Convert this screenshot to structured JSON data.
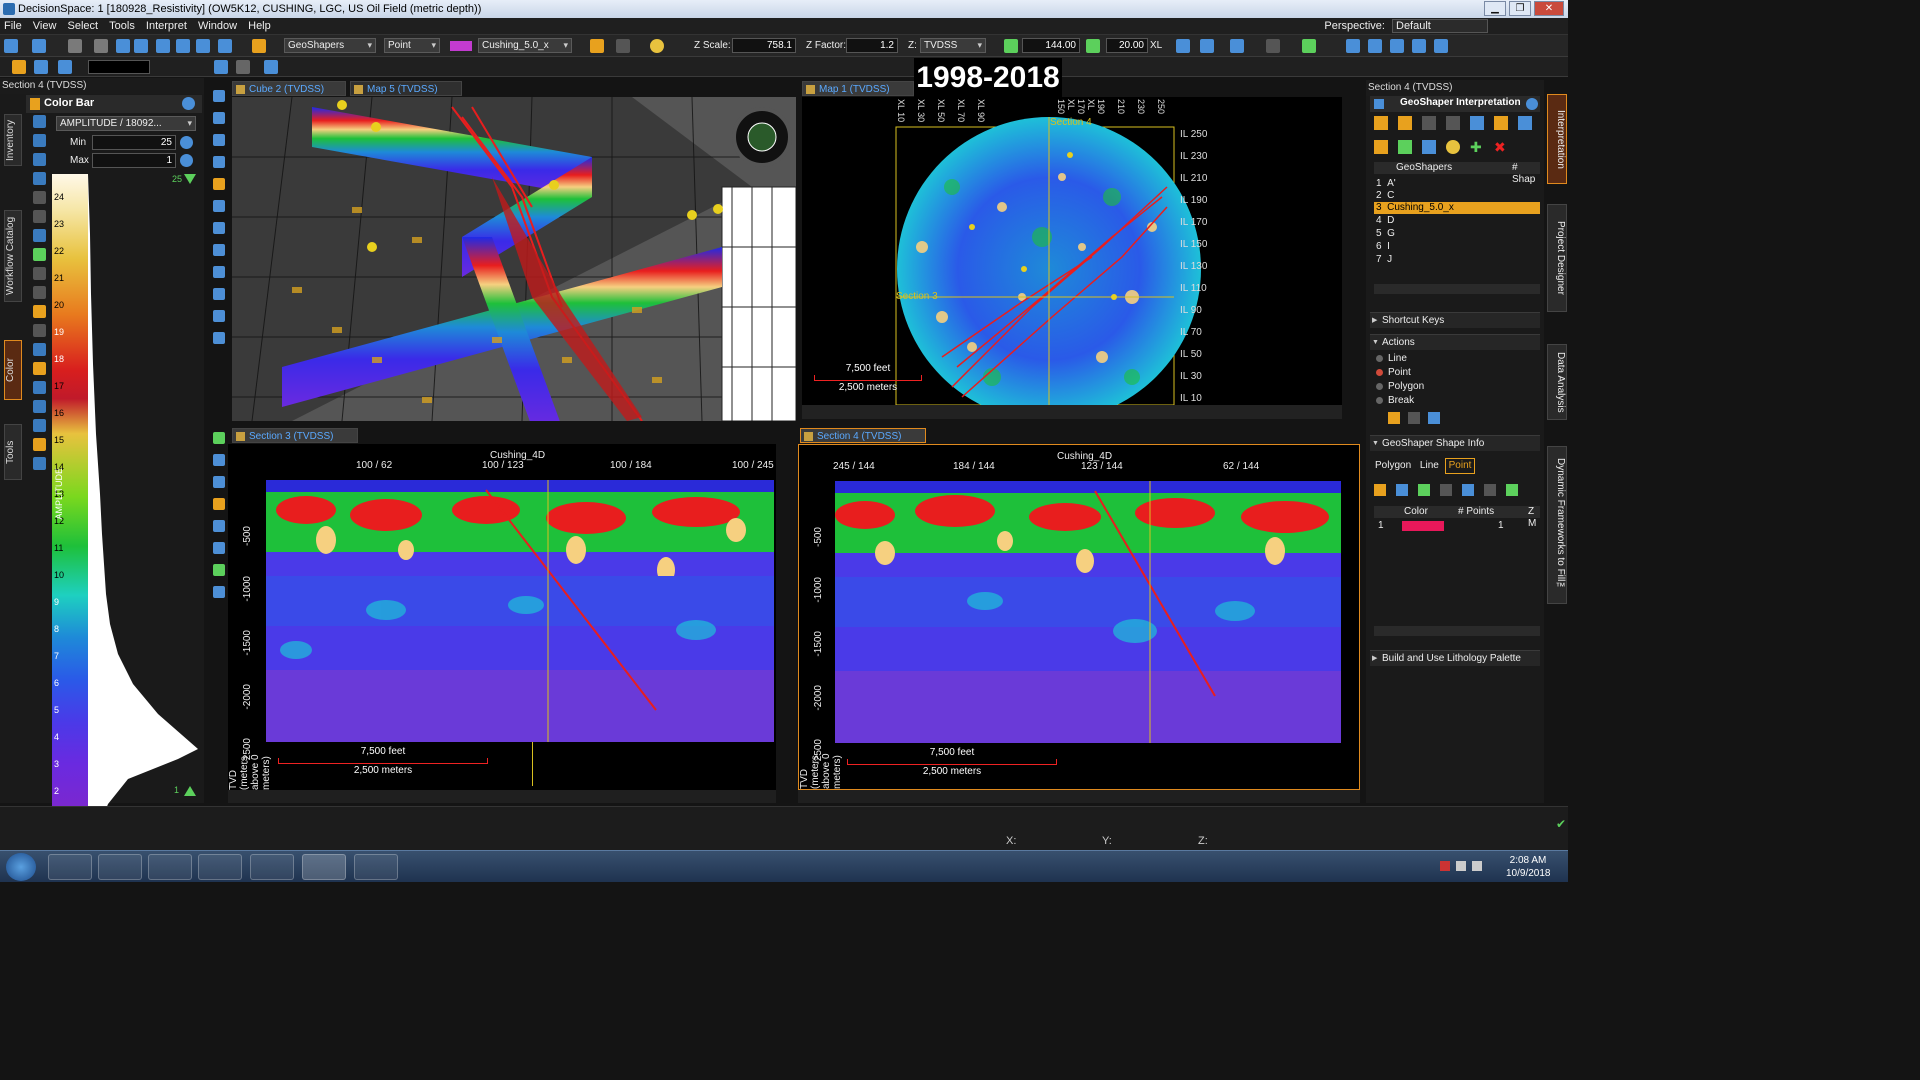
{
  "window": {
    "title": "DecisionSpace: 1 [180928_Resistivity] (OW5K12, CUSHING, LGC, US Oil Field (metric depth))"
  },
  "menu": [
    "File",
    "View",
    "Select",
    "Tools",
    "Interpret",
    "Window",
    "Help"
  ],
  "perspective": {
    "label": "Perspective:",
    "value": "Default"
  },
  "toolbar": {
    "geoshapers": "GeoShapers",
    "mode": "Point",
    "shape": "Cushing_5.0_x",
    "zscale_label": "Z Scale:",
    "zscale": "758.1",
    "zfactor_label": "Z Factor:",
    "zfactor": "1.2",
    "z_label": "Z:",
    "z_domain": "TVDSS",
    "time_value": "144.00",
    "step_value": "20.00",
    "xl_label": "XL"
  },
  "overlay_date": "1998-2018",
  "left_panel": {
    "title": "Section 4 (TVDSS)",
    "colorbar_title": "Color Bar",
    "attribute": "AMPLITUDE / 18092...",
    "min_label": "Min",
    "min_value": "25",
    "max_label": "Max",
    "max_value": "1",
    "axis_label": "AMPLITUDE",
    "ticks": [
      "24",
      "23",
      "22",
      "21",
      "20",
      "19",
      "18",
      "17",
      "16",
      "15",
      "14",
      "13",
      "12",
      "11",
      "10",
      "9",
      "8",
      "7",
      "6",
      "5",
      "4",
      "3",
      "2"
    ],
    "top_marker": "25",
    "bottom_marker": "1",
    "side_tabs": [
      "Inventory",
      "Workflow Catalog",
      "Color",
      "Tools"
    ]
  },
  "views": {
    "cube": {
      "tab": "Cube 2 (TVDSS)"
    },
    "map5": {
      "tab": "Map 5 (TVDSS)"
    },
    "map1": {
      "tab": "Map 1 (TVDSS)",
      "top_ticks": [
        "XL 10",
        "XL 30",
        "XL 50",
        "XL 70",
        "XL 90",
        "XL 150",
        "XL 170",
        "190",
        "210",
        "230",
        "250"
      ],
      "right_ticks": [
        "IL 250",
        "IL 230",
        "IL 210",
        "IL 190",
        "IL 170",
        "IL 150",
        "IL 130",
        "IL 110",
        "IL 90",
        "IL 70",
        "IL 50",
        "IL 30",
        "IL 10"
      ],
      "section_label_top": "Section 4",
      "section_label_left": "Section 3",
      "scale_feet": "7,500 feet",
      "scale_meters": "2,500 meters"
    },
    "section3": {
      "tab": "Section 3 (TVDSS)",
      "horizon": "Cushing_4D",
      "top_ticks": [
        "100 / 62",
        "100 / 123",
        "100 / 184",
        "100 / 245"
      ],
      "ylabel": "TVD (meters above 0 meters)",
      "yticks": [
        "-500",
        "-1000",
        "-1500",
        "-2000",
        "-2500"
      ],
      "scale_feet": "7,500 feet",
      "scale_meters": "2,500 meters"
    },
    "section4": {
      "tab": "Section 4 (TVDSS)",
      "horizon": "Cushing_4D",
      "top_ticks": [
        "245 / 144",
        "184 / 144",
        "123 / 144",
        "62 / 144"
      ],
      "ylabel": "TVD (meters above 0 meters)",
      "yticks": [
        "-500",
        "-1000",
        "-1500",
        "-2000",
        "-2500"
      ],
      "scale_feet": "7,500 feet",
      "scale_meters": "2,500 meters"
    }
  },
  "right_panel": {
    "title": "Section 4 (TVDSS)",
    "header": "GeoShaper Interpretation",
    "col_name": "GeoShapers",
    "col_count": "# Shap",
    "rows": [
      {
        "n": "1",
        "name": "A'"
      },
      {
        "n": "2",
        "name": "C"
      },
      {
        "n": "3",
        "name": "Cushing_5.0_x"
      },
      {
        "n": "4",
        "name": "D"
      },
      {
        "n": "5",
        "name": "G"
      },
      {
        "n": "6",
        "name": "I"
      },
      {
        "n": "7",
        "name": "J"
      }
    ],
    "shortcut_keys": "Shortcut Keys",
    "actions": "Actions",
    "action_items": [
      "Line",
      "Point",
      "Polygon",
      "Break"
    ],
    "shape_info": "GeoShaper Shape Info",
    "shape_tabs": [
      "Polygon",
      "Line",
      "Point"
    ],
    "info_cols": [
      "Color",
      "# Points",
      "Z M"
    ],
    "info_row": {
      "n": "1",
      "points": "1",
      "color": "#e8185a"
    },
    "lithology": "Build and Use Lithology Palette",
    "vertical_tabs": [
      "Interpretation",
      "Project Designer",
      "Data Analysis",
      "Dynamic Frameworks to Fill™"
    ]
  },
  "status": {
    "x": "X:",
    "y": "Y:",
    "z": "Z:"
  },
  "clock": {
    "time": "2:08 AM",
    "date": "10/9/2018"
  }
}
